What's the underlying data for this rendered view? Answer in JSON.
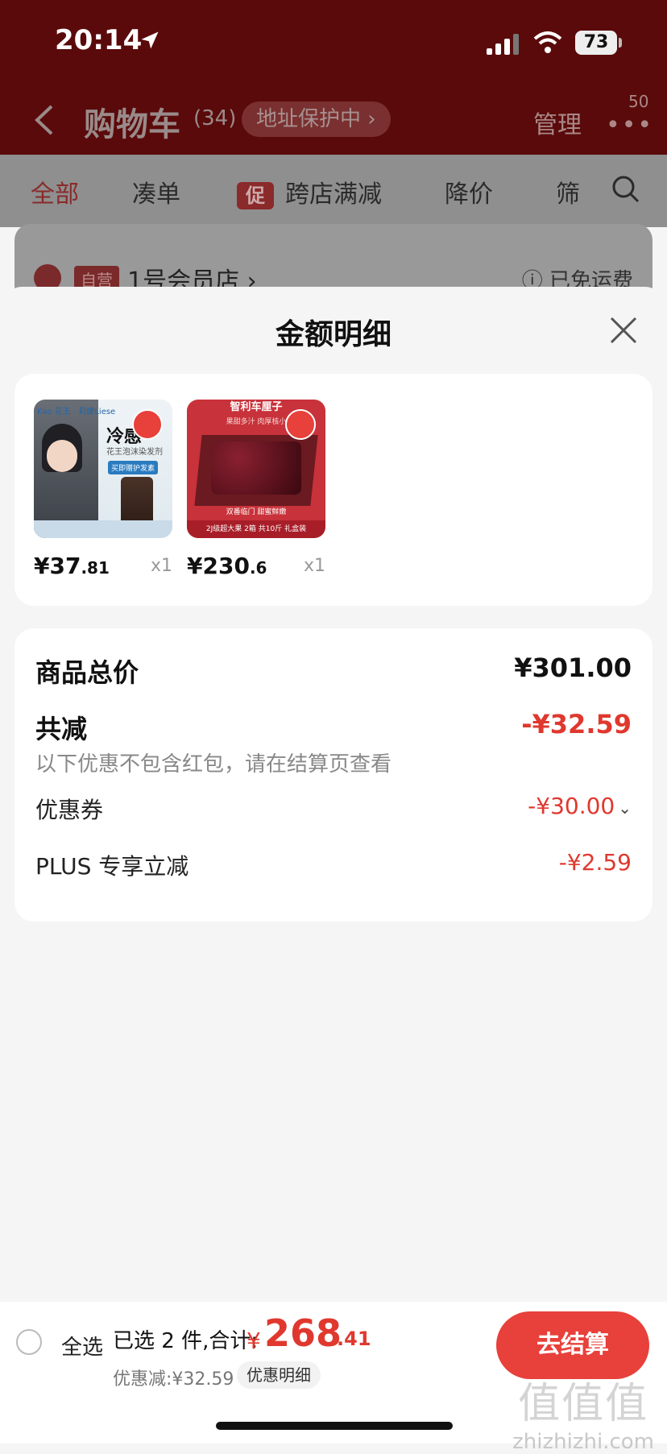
{
  "status_bar": {
    "time": "20:14",
    "battery": "73"
  },
  "nav": {
    "title": "购物车",
    "count": "(34)",
    "address_pill": "地址保护中 ›",
    "manage": "管理",
    "more_badge": "50"
  },
  "tabs": [
    {
      "label": "全部"
    },
    {
      "label": "凑单"
    },
    {
      "label": "跨店满减",
      "tag": "促"
    },
    {
      "label": "降价"
    },
    {
      "label": "筛"
    }
  ],
  "store": {
    "self_tag": "自营",
    "name": "1号会员店 ›",
    "shipping": "ⓘ 已免运费"
  },
  "sheet": {
    "title": "金额明细",
    "products": [
      {
        "price_main": "¥37",
        "price_dec": ".81",
        "qty": "x1",
        "thumb_brand": "Kao 花王 · 莉婕Liese",
        "thumb_title": "冷感",
        "thumb_line": "花王泡沫染发剂",
        "thumb_badge": "买即赠护发素"
      },
      {
        "price_main": "¥230",
        "price_dec": ".6",
        "qty": "x1",
        "thumb_title": "智利车厘子",
        "thumb_line": "果甜多汁  肉厚核小",
        "thumb_footer": "双番临门  甜蜜鲜嫩",
        "thumb_footer2": "2J级超大果 2箱 共10斤 礼盒装"
      }
    ],
    "summary": {
      "total_label": "商品总价",
      "total_value": "¥301.00",
      "discount_label": "共减",
      "discount_value": "-¥32.59",
      "discount_note": "以下优惠不包含红包，请在结算页查看",
      "coupon_label": "优惠券",
      "coupon_value": "-¥30.00",
      "plus_label": "PLUS 专享立减",
      "plus_value": "-¥2.59"
    }
  },
  "bottom": {
    "select_all": "全选",
    "selected_text": "已选 2 件,合计:",
    "currency": "¥",
    "total_main": "268",
    "total_dec": ".41",
    "saved": "优惠减:¥32.59",
    "detail_pill": "优惠明细",
    "checkout": "去结算"
  },
  "watermark": {
    "text": "zhizhizhi.com",
    "mark": "值值值"
  }
}
